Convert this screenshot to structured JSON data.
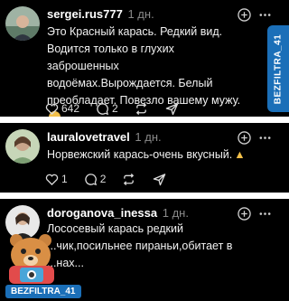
{
  "comments": [
    {
      "username": "sergei.rus777",
      "date": "1 дн.",
      "text": "Это Красный карась. Редкий вид. Водится только в глухих заброшенных водоёмах.Вырождается. Белый преобладает. Повезло вашему мужу.",
      "likes": "642",
      "replies": "2"
    },
    {
      "username": "lauralovetravel",
      "date": "1 дн.",
      "text": "Норвежский карась-очень вкусный.",
      "likes": "1",
      "replies": "2"
    },
    {
      "username": "doroganova_inessa",
      "date": "1 дн.",
      "text": "Лососевый карась редкий ...чик,посильнее пираньи,обитает в ...нах..."
    }
  ],
  "watermark": {
    "vertical": "BEZFILTRA_41",
    "bottom": "BEZFILTRA_41"
  },
  "colors": {
    "background": "#000000",
    "separator": "#ffffff",
    "watermark": "#1b6fb8"
  },
  "icons": [
    "add-icon",
    "more-icon",
    "heart-icon",
    "comment-icon",
    "repost-icon",
    "share-icon"
  ]
}
